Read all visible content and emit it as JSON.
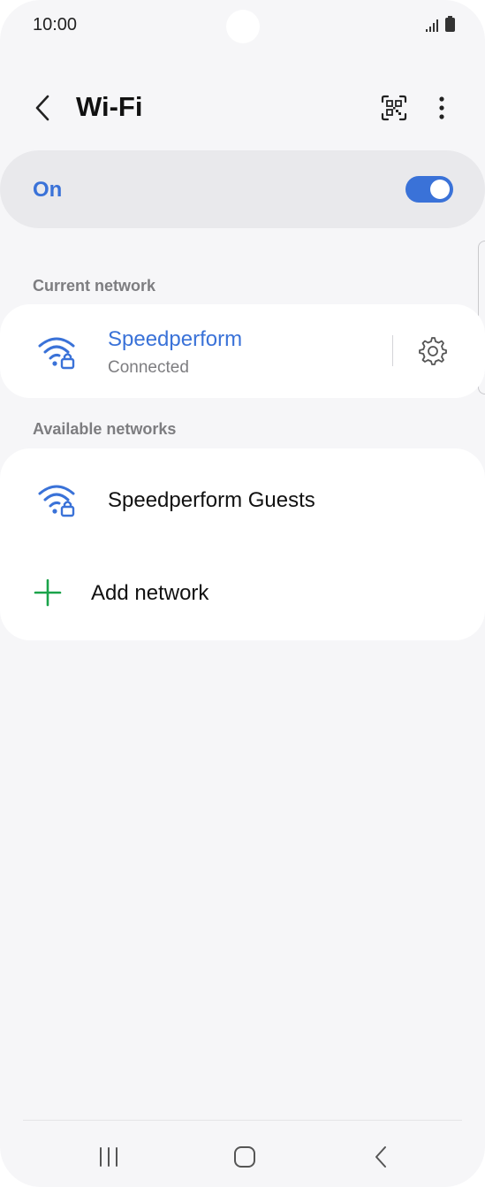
{
  "status_bar": {
    "time": "10:00",
    "icons": [
      "signal-icon",
      "battery-icon"
    ]
  },
  "header": {
    "title": "Wi-Fi",
    "icons": [
      "back-arrow-icon",
      "qr-code-icon",
      "more-options-icon"
    ]
  },
  "wifi_toggle": {
    "label": "On",
    "state": "on",
    "accent_color": "#3a72d8"
  },
  "current_network": {
    "section_label": "Current network",
    "name": "Speedperform",
    "status": "Connected",
    "icons": [
      "wifi-locked-icon",
      "gear-icon"
    ]
  },
  "available_networks": {
    "section_label": "Available networks",
    "items": [
      {
        "name": "Speedperform Guests",
        "icon": "wifi-locked-icon"
      }
    ],
    "add_network_label": "Add network",
    "add_icon_color": "#1aa34a"
  },
  "nav_bar": {
    "icons": [
      "recent-apps-icon",
      "home-icon",
      "back-icon"
    ]
  }
}
